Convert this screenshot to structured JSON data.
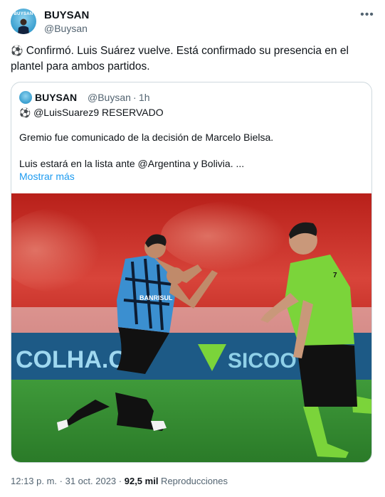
{
  "author": {
    "display_name": "BUYSAN",
    "handle": "@Buysan",
    "avatar_text": "BUYSAN"
  },
  "tweet": {
    "emoji": "⚽",
    "text": " Confirmó. Luis Suárez vuelve. Está confirmado su presencia en el plantel para ambos partidos."
  },
  "quoted": {
    "display_name": "BUYSAN",
    "handle": "@Buysan",
    "separator": "·",
    "time": "1h",
    "line1_emoji": "⚽",
    "line1": " @LuisSuarez9 RESERVADO",
    "line2": "Gremio fue comunicado de la decisión de Marcelo Bielsa.",
    "line3": "Luis estará en la lista ante @Argentina y Bolivia. ...",
    "show_more": "Mostrar más"
  },
  "media": {
    "board_text_left": "COLHA.CO",
    "board_text_right": "SICOO",
    "jersey_text": "BANRISUL",
    "referee_number": "7"
  },
  "footer": {
    "time": "12:13 p. m.",
    "sep1": " · ",
    "date": "31 oct. 2023",
    "sep2": " · ",
    "views_count": "92,5 mil",
    "views_label": " Reproducciones"
  },
  "colors": {
    "link": "#1d9bf0",
    "secondary_text": "#536471",
    "border": "#cfd9de",
    "pitch_green": "#2f7d2c",
    "crowd_red": "#c8281e",
    "gremio_blue": "#3b8fd0",
    "referee_green": "#7bd43a"
  },
  "icons": {
    "more": "more-horizontal-icon",
    "soccer": "soccer-ball-emoji"
  }
}
